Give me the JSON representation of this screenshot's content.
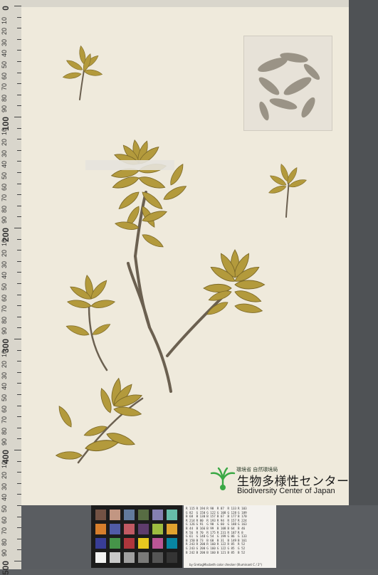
{
  "ruler": {
    "labels": [
      "0",
      "10",
      "20",
      "30",
      "40",
      "50",
      "60",
      "70",
      "80",
      "90",
      "100",
      "10",
      "20",
      "30",
      "40",
      "50",
      "60",
      "70",
      "80",
      "90",
      "200",
      "10",
      "20",
      "30",
      "40",
      "50",
      "60",
      "70",
      "80",
      "90",
      "300",
      "10",
      "20",
      "30",
      "40",
      "50",
      "60",
      "70",
      "80",
      "90",
      "400",
      "10",
      "20",
      "30",
      "40",
      "50",
      "60",
      "70",
      "80",
      "90",
      "500"
    ]
  },
  "institution": {
    "small_jp": "環境省 自然環境局",
    "name_jp": "生物多様性センター",
    "name_en": "Biodiversity Center of Japan"
  },
  "color_checker": {
    "caption": "by GretagMacbeth color checker (Illuminant C / 2°)",
    "patches": [
      "#735244",
      "#c29682",
      "#627a9d",
      "#576c43",
      "#8580b1",
      "#67bdaa",
      "#d67e2c",
      "#505ba6",
      "#c15a63",
      "#5e3c6c",
      "#9dbc40",
      "#e0a32e",
      "#383d96",
      "#469449",
      "#af363c",
      "#e7c71f",
      "#bb5695",
      "#0885a1",
      "#f3f3f2",
      "#c8c8c8",
      "#a0a0a0",
      "#7a7a79",
      "#555555",
      "#343434"
    ],
    "table_rows": [
      [
        "R 115",
        "R 194",
        "R 98",
        "R 87",
        "R 133",
        "R 103"
      ],
      [
        "G 82",
        "G 150",
        "G 122",
        "G 108",
        "G 128",
        "G 189"
      ],
      [
        "B 68",
        "B 130",
        "B 157",
        "B 67",
        "B 177",
        "B 170"
      ],
      [
        "R 214",
        "R 80",
        "R 193",
        "R 94",
        "R 157",
        "R 224"
      ],
      [
        "G 126",
        "G 91",
        "G 90",
        "G 60",
        "G 188",
        "G 163"
      ],
      [
        "B 44",
        "B 166",
        "B 99",
        "B 108",
        "B 64",
        "B 46"
      ],
      [
        "R 56",
        "R 70",
        "R 175",
        "R 231",
        "R 187",
        "R 8"
      ],
      [
        "G 61",
        "G 148",
        "G 54",
        "G 199",
        "G 86",
        "G 133"
      ],
      [
        "B 150",
        "B 73",
        "B 60",
        "B 31",
        "B 149",
        "B 161"
      ],
      [
        "R 243",
        "R 200",
        "R 160",
        "R 122",
        "R 85",
        "R 52"
      ],
      [
        "G 243",
        "G 200",
        "G 160",
        "G 122",
        "G 85",
        "G 52"
      ],
      [
        "B 242",
        "B 200",
        "B 160",
        "B 121",
        "B 85",
        "B 52"
      ]
    ]
  },
  "colors": {
    "sheet": "#efeadc",
    "leaf": "#b39a3c",
    "leaf_dark": "#7d6a28",
    "stem": "#6b6050",
    "logo_green": "#3aa844"
  }
}
